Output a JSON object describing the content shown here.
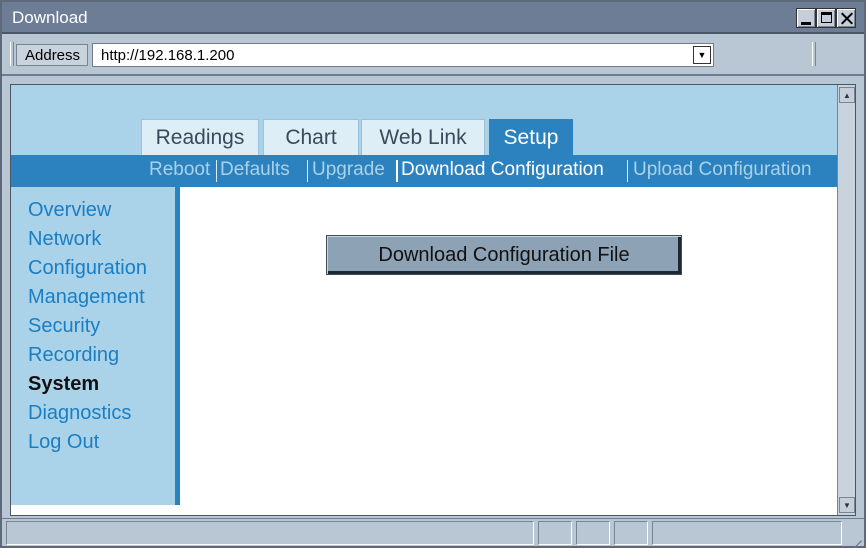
{
  "window": {
    "title": "Download"
  },
  "address_bar": {
    "label": "Address",
    "url": "http://192.168.1.200"
  },
  "tabs": [
    {
      "label": "Readings",
      "active": false
    },
    {
      "label": "Chart",
      "active": false
    },
    {
      "label": "Web Link",
      "active": false
    },
    {
      "label": "Setup",
      "active": true
    }
  ],
  "subnav": [
    {
      "label": "Reboot",
      "current": false
    },
    {
      "label": "Defaults",
      "current": false
    },
    {
      "label": "Upgrade",
      "current": false
    },
    {
      "label": "Download Configuration",
      "current": true
    },
    {
      "label": "Upload Configuration",
      "current": false
    }
  ],
  "sidebar": {
    "items": [
      {
        "label": "Overview",
        "selected": false
      },
      {
        "label": "Network",
        "selected": false
      },
      {
        "label": "Configuration",
        "selected": false
      },
      {
        "label": "Management",
        "selected": false
      },
      {
        "label": "Security",
        "selected": false
      },
      {
        "label": "Recording",
        "selected": false
      },
      {
        "label": "System",
        "selected": true
      },
      {
        "label": "Diagnostics",
        "selected": false
      },
      {
        "label": "Log Out",
        "selected": false
      }
    ]
  },
  "main": {
    "button_label": "Download Configuration File"
  },
  "colors": {
    "header_bg": "#aad3ea",
    "accent_blue": "#2b82be",
    "link_blue": "#1a7ec4",
    "titlebar": "#6d7d95"
  },
  "icons": {
    "minimize": "minimize-icon",
    "maximize": "maximize-icon",
    "close": "close-icon",
    "dropdown": "chevron-down-icon",
    "scroll_up": "scroll-up-icon",
    "scroll_down": "scroll-down-icon"
  }
}
